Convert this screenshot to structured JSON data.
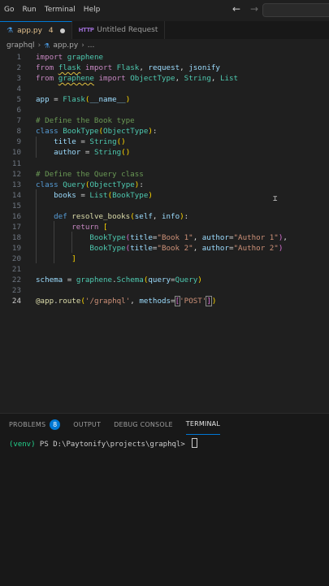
{
  "menu": [
    "Go",
    "Run",
    "Terminal",
    "Help"
  ],
  "nav": {
    "back_icon": "←",
    "forward_icon": "→"
  },
  "tabs": [
    {
      "label": "app.py",
      "count": "4",
      "active": true,
      "modified": true
    },
    {
      "label": "Untitled Request",
      "icon_text": "HTTP",
      "active": false
    }
  ],
  "breadcrumb": {
    "folder": "graphql",
    "file": "app.py",
    "more": "..."
  },
  "editor": {
    "line_numbers": [
      "1",
      "2",
      "3",
      "4",
      "5",
      "6",
      "7",
      "8",
      "9",
      "10",
      "11",
      "12",
      "13",
      "14",
      "15",
      "16",
      "17",
      "18",
      "19",
      "20",
      "21",
      "22",
      "23",
      "24"
    ],
    "current_line": 24
  },
  "code_lines": [
    [
      [
        "kw",
        "import"
      ],
      [
        "punc",
        " "
      ],
      [
        "cls",
        "graphene"
      ]
    ],
    [
      [
        "kw",
        "from"
      ],
      [
        "punc",
        " "
      ],
      [
        "cls",
        "flask"
      ],
      [
        "punc",
        " "
      ],
      [
        "kw",
        "import"
      ],
      [
        "punc",
        " "
      ],
      [
        "cls",
        "Flask"
      ],
      [
        "punc",
        ", "
      ],
      [
        "var",
        "request"
      ],
      [
        "punc",
        ", "
      ],
      [
        "var",
        "jsonify"
      ]
    ],
    [
      [
        "kw",
        "from"
      ],
      [
        "punc",
        " "
      ],
      [
        "cls",
        "graphene"
      ],
      [
        "punc",
        " "
      ],
      [
        "kw",
        "import"
      ],
      [
        "punc",
        " "
      ],
      [
        "cls",
        "ObjectType"
      ],
      [
        "punc",
        ", "
      ],
      [
        "cls",
        "String"
      ],
      [
        "punc",
        ", "
      ],
      [
        "cls",
        "List"
      ]
    ],
    [],
    [
      [
        "var",
        "app"
      ],
      [
        "punc",
        " = "
      ],
      [
        "cls",
        "Flask"
      ],
      [
        "bracket1",
        "("
      ],
      [
        "var",
        "__name__"
      ],
      [
        "bracket1",
        ")"
      ]
    ],
    [],
    [
      [
        "cmt",
        "# Define the Book type"
      ]
    ],
    [
      [
        "def",
        "class"
      ],
      [
        "punc",
        " "
      ],
      [
        "cls",
        "BookType"
      ],
      [
        "bracket1",
        "("
      ],
      [
        "cls",
        "ObjectType"
      ],
      [
        "bracket1",
        ")"
      ],
      [
        "punc",
        ":"
      ]
    ],
    [
      [
        "punc",
        "    "
      ],
      [
        "var",
        "title"
      ],
      [
        "punc",
        " = "
      ],
      [
        "cls",
        "String"
      ],
      [
        "bracket1",
        "()"
      ]
    ],
    [
      [
        "punc",
        "    "
      ],
      [
        "var",
        "author"
      ],
      [
        "punc",
        " = "
      ],
      [
        "cls",
        "String"
      ],
      [
        "bracket1",
        "()"
      ]
    ],
    [],
    [
      [
        "cmt",
        "# Define the Query class"
      ]
    ],
    [
      [
        "def",
        "class"
      ],
      [
        "punc",
        " "
      ],
      [
        "cls",
        "Query"
      ],
      [
        "bracket1",
        "("
      ],
      [
        "cls",
        "ObjectType"
      ],
      [
        "bracket1",
        ")"
      ],
      [
        "punc",
        ":"
      ]
    ],
    [
      [
        "punc",
        "    "
      ],
      [
        "var",
        "books"
      ],
      [
        "punc",
        " = "
      ],
      [
        "cls",
        "List"
      ],
      [
        "bracket1",
        "("
      ],
      [
        "cls",
        "BookType"
      ],
      [
        "bracket1",
        ")"
      ]
    ],
    [],
    [
      [
        "punc",
        "    "
      ],
      [
        "def",
        "def"
      ],
      [
        "punc",
        " "
      ],
      [
        "fn",
        "resolve_books"
      ],
      [
        "bracket1",
        "("
      ],
      [
        "var",
        "self"
      ],
      [
        "punc",
        ", "
      ],
      [
        "var",
        "info"
      ],
      [
        "bracket1",
        ")"
      ],
      [
        "punc",
        ":"
      ]
    ],
    [
      [
        "punc",
        "        "
      ],
      [
        "kw",
        "return"
      ],
      [
        "punc",
        " "
      ],
      [
        "bracket1",
        "["
      ]
    ],
    [
      [
        "punc",
        "            "
      ],
      [
        "cls",
        "BookType"
      ],
      [
        "bracket2",
        "("
      ],
      [
        "var",
        "title"
      ],
      [
        "punc",
        "="
      ],
      [
        "str",
        "\"Book 1\""
      ],
      [
        "punc",
        ", "
      ],
      [
        "var",
        "author"
      ],
      [
        "punc",
        "="
      ],
      [
        "str",
        "\"Author 1\""
      ],
      [
        "bracket2",
        ")"
      ],
      [
        "punc",
        ","
      ]
    ],
    [
      [
        "punc",
        "            "
      ],
      [
        "cls",
        "BookType"
      ],
      [
        "bracket2",
        "("
      ],
      [
        "var",
        "title"
      ],
      [
        "punc",
        "="
      ],
      [
        "str",
        "\"Book 2\""
      ],
      [
        "punc",
        ", "
      ],
      [
        "var",
        "author"
      ],
      [
        "punc",
        "="
      ],
      [
        "str",
        "\"Author 2\""
      ],
      [
        "bracket2",
        ")"
      ]
    ],
    [
      [
        "punc",
        "        "
      ],
      [
        "bracket1",
        "]"
      ]
    ],
    [],
    [
      [
        "var",
        "schema"
      ],
      [
        "punc",
        " = "
      ],
      [
        "cls",
        "graphene"
      ],
      [
        "punc",
        "."
      ],
      [
        "cls",
        "Schema"
      ],
      [
        "bracket1",
        "("
      ],
      [
        "var",
        "query"
      ],
      [
        "punc",
        "="
      ],
      [
        "cls",
        "Query"
      ],
      [
        "bracket1",
        ")"
      ]
    ],
    [],
    [
      [
        "fn",
        "@app"
      ],
      [
        "punc",
        "."
      ],
      [
        "fn",
        "route"
      ],
      [
        "bracket1",
        "("
      ],
      [
        "str",
        "'/graphql'"
      ],
      [
        "punc",
        ", "
      ],
      [
        "var",
        "methods"
      ],
      [
        "punc",
        "="
      ],
      [
        "bracket2box",
        "["
      ],
      [
        "str",
        "'POST'"
      ],
      [
        "bracket2box",
        "]"
      ],
      [
        "caret",
        ""
      ],
      [
        "bracket1",
        ")"
      ]
    ]
  ],
  "panel": {
    "tabs": [
      {
        "label": "PROBLEMS",
        "badge": "8"
      },
      {
        "label": "OUTPUT"
      },
      {
        "label": "DEBUG CONSOLE"
      },
      {
        "label": "TERMINAL",
        "active": true
      }
    ],
    "terminal": {
      "venv": "(venv)",
      "prompt": " PS D:\\Paytonify\\projects\\graphql> "
    }
  },
  "colors": {
    "accent": "#0078d4",
    "modified": "#e2c08d",
    "badge": "#0078d4"
  }
}
